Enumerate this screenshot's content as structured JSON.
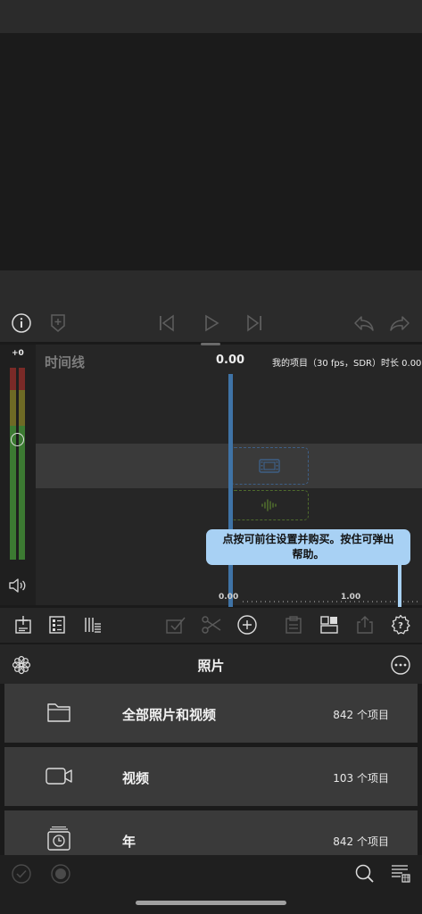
{
  "timeline": {
    "label": "时间线",
    "time": "0.00",
    "project_info": "我的项目（30 fps，SDR）时长 0.00",
    "ruler_start": "0.00",
    "ruler_mark": "1.00"
  },
  "meter": {
    "gain_label": "+0"
  },
  "tooltip": {
    "text_line1": "点按可前往设置并购买。按住可弹出",
    "text_line2": "帮助。"
  },
  "browser": {
    "title": "照片",
    "rows": [
      {
        "name": "全部照片和视频",
        "count": "842 个项目",
        "icon": "folder-icon"
      },
      {
        "name": "视频",
        "count": "103 个项目",
        "icon": "video-camera-icon"
      },
      {
        "name": "年",
        "count": "842 个项目",
        "icon": "calendar-clock-icon"
      }
    ]
  },
  "colors": {
    "playhead": "#3f73a6",
    "tooltip_bg": "#a8d1f4",
    "meter_green": "#3e8a33",
    "meter_red": "#8a2f2a"
  }
}
